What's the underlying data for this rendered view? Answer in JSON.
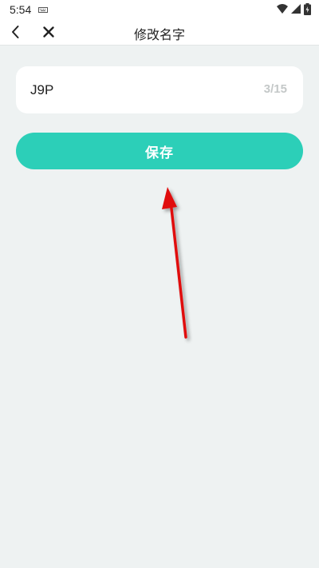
{
  "status_bar": {
    "time": "5:54",
    "icons": [
      "keyboard-icon",
      "wifi-icon",
      "signal-icon",
      "battery-icon"
    ]
  },
  "app_bar": {
    "title": "修改名字",
    "back_icon": "chevron-left-icon",
    "close_icon": "close-icon"
  },
  "name_field": {
    "value": "J9P",
    "counter": "3/15"
  },
  "save_button": {
    "label": "保存"
  },
  "colors": {
    "background": "#eef2f2",
    "accent": "#2ccfb8",
    "annotation_arrow": "#e01010",
    "counter_text": "#c4c8c8"
  }
}
